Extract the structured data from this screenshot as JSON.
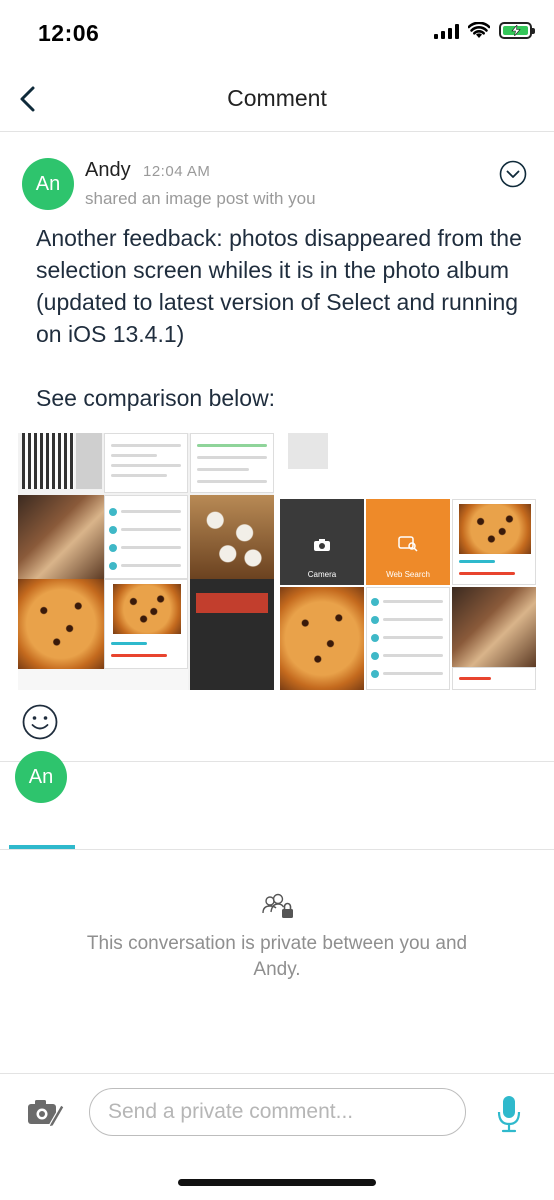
{
  "status_bar": {
    "time": "12:06",
    "battery_color": "#34c759",
    "icons": [
      "signal-icon",
      "wifi-icon",
      "battery-charging-icon"
    ]
  },
  "header": {
    "title": "Comment",
    "back_icon": "chevron-left-icon"
  },
  "post": {
    "avatar_initials": "An",
    "avatar_color": "#2ec46d",
    "author": "Andy",
    "time": "12:04 AM",
    "subtitle": "shared an image post with you",
    "body_paragraph_1": "Another feedback: photos disappeared from the selection screen whiles it is in the photo album (updated to latest version of Select and running on iOS 13.4.1)",
    "body_paragraph_2": "See comparison below:",
    "menu_icon": "chevron-down-circle-icon",
    "images": [
      {
        "screenshot_labels": [
          "Camera",
          "Web Search"
        ]
      }
    ],
    "reaction_icon": "smiley-icon"
  },
  "tabs": [
    {
      "avatar_initials": "An",
      "active": true,
      "accent_color": "#2fb9cc"
    }
  ],
  "private_notice": {
    "icon": "private-users-lock-icon",
    "text": "This conversation is private between you and Andy."
  },
  "composer": {
    "placeholder": "Send a private comment...",
    "value": "",
    "camera_icon": "camera-edit-icon",
    "mic_icon": "microphone-icon",
    "mic_color": "#2fb9cc"
  }
}
